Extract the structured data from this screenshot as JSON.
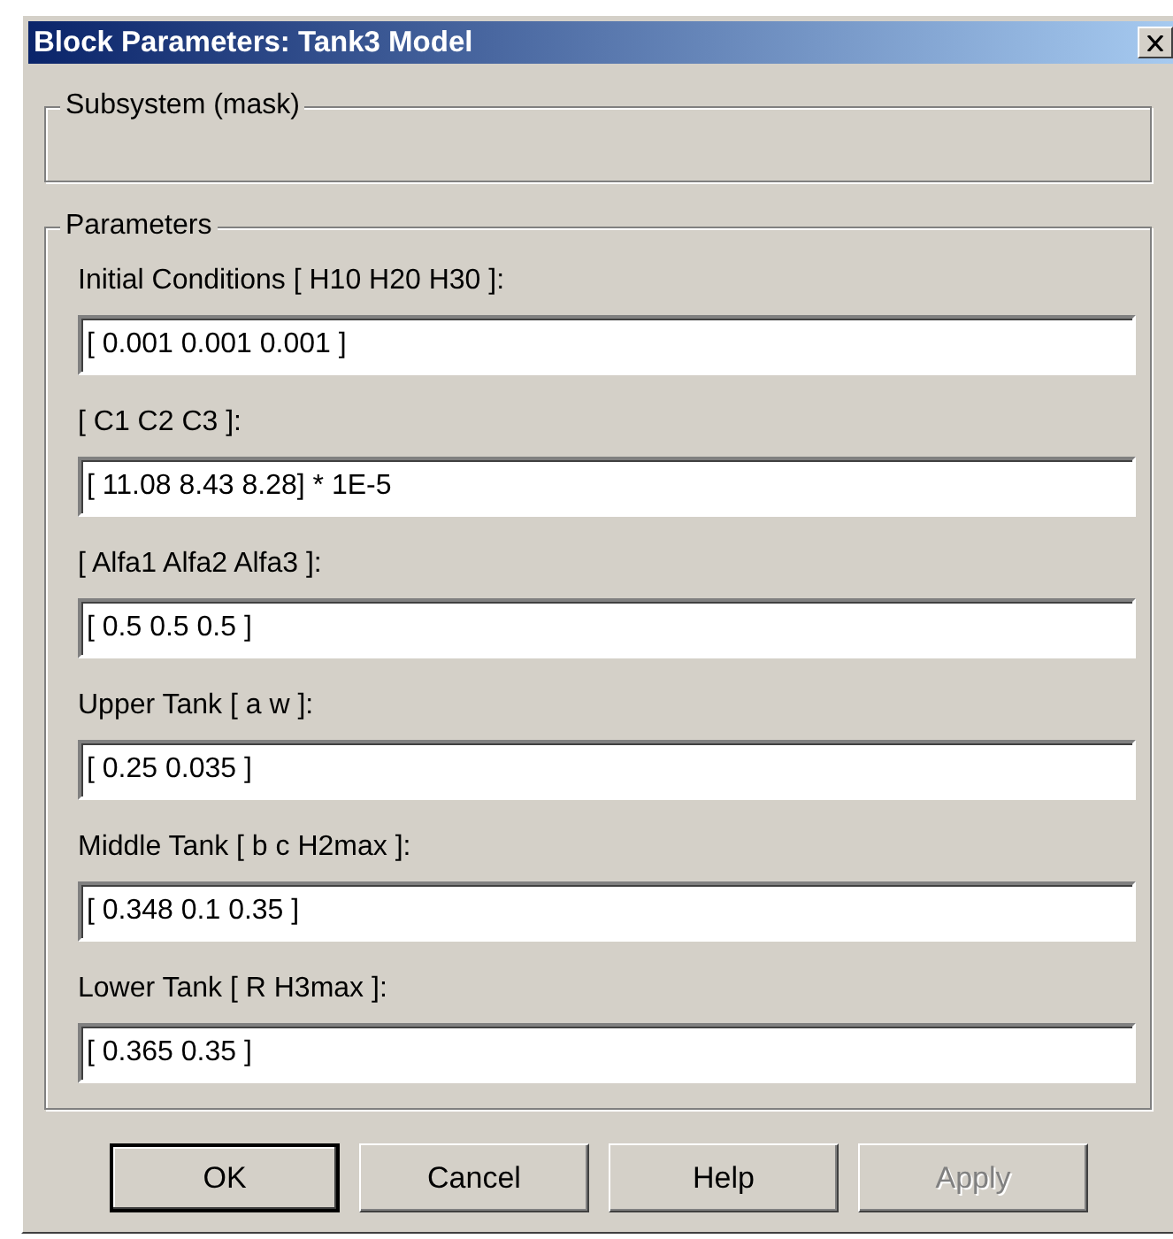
{
  "window": {
    "title": "Block Parameters: Tank3 Model"
  },
  "mask_group": {
    "title": "Subsystem (mask)"
  },
  "parameters_group": {
    "title": "Parameters",
    "fields": [
      {
        "label": "Initial Conditions [ H10 H20 H30 ]:",
        "value": "[ 0.001 0.001 0.001 ]"
      },
      {
        "label": "[ C1 C2 C3 ]:",
        "value": "[ 11.08 8.43 8.28] * 1E-5"
      },
      {
        "label": "[ Alfa1 Alfa2 Alfa3 ]:",
        "value": "[ 0.5 0.5 0.5 ]"
      },
      {
        "label": "Upper Tank [ a w ]:",
        "value": "[ 0.25 0.035 ]"
      },
      {
        "label": "Middle Tank [ b c H2max ]:",
        "value": "[ 0.348 0.1 0.35 ]"
      },
      {
        "label": "Lower Tank [ R H3max ]:",
        "value": "[ 0.365 0.35 ]"
      }
    ]
  },
  "buttons": [
    {
      "label": "OK",
      "default": true,
      "disabled": false
    },
    {
      "label": "Cancel",
      "default": false,
      "disabled": false
    },
    {
      "label": "Help",
      "default": false,
      "disabled": false
    },
    {
      "label": "Apply",
      "default": false,
      "disabled": true
    }
  ]
}
